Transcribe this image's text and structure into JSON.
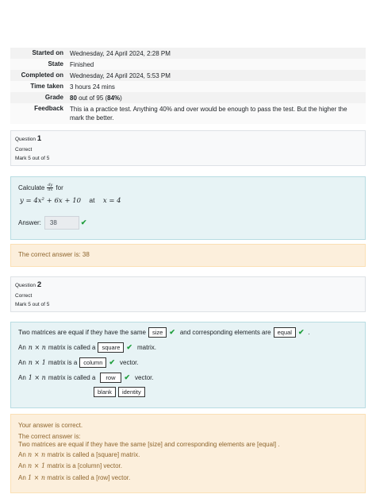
{
  "summary": {
    "started_label": "Started on",
    "started_value": "Wednesday, 24 April 2024, 2:28 PM",
    "state_label": "State",
    "state_value": "Finished",
    "completed_label": "Completed on",
    "completed_value": "Wednesday, 24 April 2024, 5:53 PM",
    "time_label": "Time taken",
    "time_value": "3 hours 24 mins",
    "grade_label": "Grade",
    "grade_mark": "80",
    "grade_text": " out of 95 (",
    "grade_percent": "84%",
    "grade_close": ")",
    "feedback_label": "Feedback",
    "feedback_value": "This ia a practice test. Anything 40% and over would be enough to pass the test. But the higher the mark the better."
  },
  "q1": {
    "label": "Question",
    "number": "1",
    "status": "Correct",
    "mark": "Mark 5 out of 5",
    "prompt_calc": "Calculate",
    "frac_num": "dy",
    "frac_den": "dx",
    "prompt_for": "for",
    "equation": "y = 4x² + 6x + 10",
    "at": "at",
    "condition": "x = 4",
    "answer_label": "Answer:",
    "answer_value": "38",
    "correct_answer": "The correct answer is: 38"
  },
  "q2": {
    "label": "Question",
    "number": "2",
    "status": "Correct",
    "mark": "Mark 5 out of 5",
    "line1_a": "Two matrices are equal if they have the same",
    "blank_size": "size",
    "line1_b": "and corresponding elements are",
    "blank_equal": "equal",
    "line1_c": ".",
    "an": "An",
    "nxn": "n × n",
    "nx1": "n × 1",
    "onexn": "1 × n",
    "called_a": "matrix is called a",
    "is_a": "matrix is a",
    "blank_square": "square",
    "blank_column": "column",
    "blank_row": "row",
    "matrix_end": "matrix.",
    "vector_end": "vector.",
    "option_blank": "blank",
    "option_identity": "identity",
    "fb_correct": "Your answer is correct.",
    "fb_heading": "The correct answer is:",
    "fb_line1": "Two matrices are equal if they have the same [size] and corresponding elements are [equal] .",
    "fb_line2_tail": "matrix is called a [square] matrix.",
    "fb_line3_tail": "matrix is a [column] vector.",
    "fb_line4_tail": "matrix is called a [row] vector."
  },
  "icons": {
    "tick": "✔"
  },
  "colors": {
    "tick": "#1f9e3c",
    "feedback_text": "#8e662e",
    "formulation_bg": "#e7f3f5",
    "feedback_bg": "#fcefdc"
  }
}
